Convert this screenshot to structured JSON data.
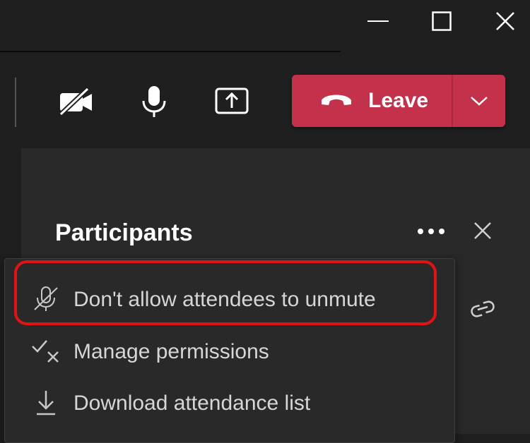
{
  "window_controls": {
    "minimize_icon": "minimize-icon",
    "maximize_icon": "maximize-icon",
    "close_icon": "close-icon"
  },
  "toolbar": {
    "camera_icon": "camera-off-icon",
    "mic_icon": "microphone-icon",
    "share_icon": "share-screen-icon",
    "leave_label": "Leave",
    "leave_icon": "phone-hangup-icon",
    "leave_menu_icon": "chevron-down-icon",
    "leave_color": "#c4314b"
  },
  "participants_pane": {
    "title": "Participants",
    "more_icon": "more-options-icon",
    "close_icon": "close-icon",
    "link_icon": "link-icon"
  },
  "menu": {
    "items": [
      {
        "label": "Don't allow attendees to unmute",
        "icon": "mic-off-icon",
        "highlighted": true
      },
      {
        "label": "Manage permissions",
        "icon": "check-x-icon"
      },
      {
        "label": "Download attendance list",
        "icon": "download-icon"
      }
    ]
  },
  "colors": {
    "background": "#1f1f1f",
    "pane": "#292929",
    "highlight": "#e21313"
  }
}
